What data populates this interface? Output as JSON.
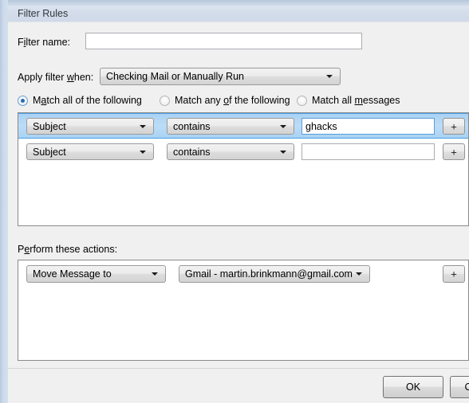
{
  "window": {
    "title": "Filter Rules"
  },
  "form": {
    "filter_name_label_pre": "F",
    "filter_name_label_acc": "i",
    "filter_name_label_post": "lter name:",
    "filter_name_value": "",
    "filter_name_placeholder": "",
    "apply_when_label_pre": "Apply filter ",
    "apply_when_label_acc": "w",
    "apply_when_label_post": "hen:",
    "apply_when_value": "Checking Mail or Manually Run"
  },
  "match_options": [
    {
      "label_pre": "M",
      "label_acc": "a",
      "label_post": "tch all of the following",
      "selected": true
    },
    {
      "label_pre": "Match any ",
      "label_acc": "o",
      "label_post": "f the following",
      "selected": false
    },
    {
      "label_pre": "Match all ",
      "label_acc": "m",
      "label_post": "essages",
      "selected": false
    }
  ],
  "conditions": {
    "rows": [
      {
        "field": "Subject",
        "operator": "contains",
        "value": "ghacks",
        "selected": true,
        "add_label": "+",
        "remove_label": "−"
      },
      {
        "field": "Subject",
        "operator": "contains",
        "value": "",
        "selected": false,
        "add_label": "+",
        "remove_label": "−"
      }
    ]
  },
  "actions": {
    "section_label_pre": "P",
    "section_label_acc": "e",
    "section_label_post": "rform these actions:",
    "rows": [
      {
        "action": "Move Message to",
        "target": "Gmail - martin.brinkmann@gmail.com",
        "add_label": "+",
        "remove_label": "−"
      }
    ]
  },
  "footer": {
    "ok_label": "OK",
    "cancel_label": "Cancel"
  }
}
